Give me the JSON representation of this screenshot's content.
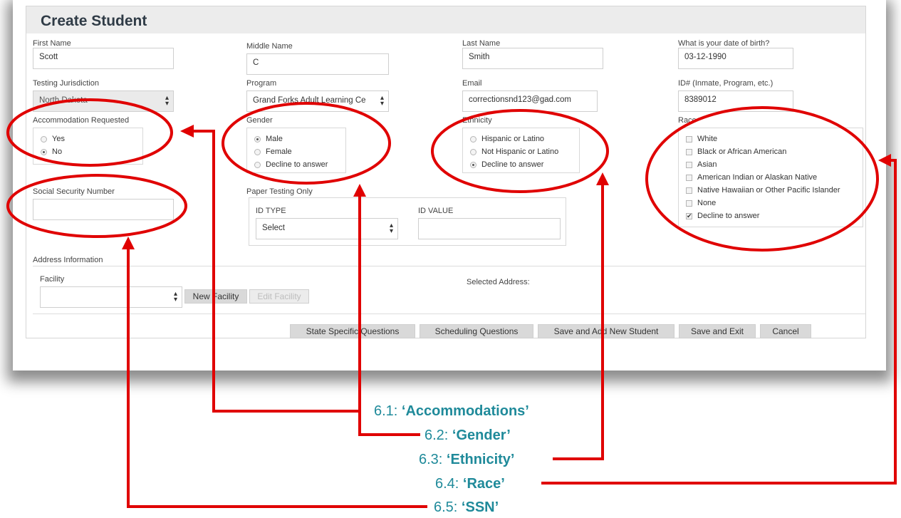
{
  "form": {
    "title": "Create Student",
    "first_name": {
      "label": "First Name",
      "value": "Scott"
    },
    "middle_name": {
      "label": "Middle Name",
      "value": "C"
    },
    "last_name": {
      "label": "Last Name",
      "value": "Smith"
    },
    "dob": {
      "label": "What is your date of birth?",
      "value": "03-12-1990"
    },
    "jurisdiction": {
      "label": "Testing Jurisdiction",
      "value": "North Dakota"
    },
    "program": {
      "label": "Program",
      "value": "Grand Forks Adult Learning Ce"
    },
    "email": {
      "label": "Email",
      "value": "correctionsnd123@gad.com"
    },
    "id_num": {
      "label": "ID# (Inmate, Program, etc.)",
      "value": "8389012"
    },
    "accommodation": {
      "label": "Accommodation Requested",
      "options": [
        "Yes",
        "No"
      ],
      "selected": "No"
    },
    "gender": {
      "label": "Gender",
      "options": [
        "Male",
        "Female",
        "Decline to answer"
      ],
      "selected": "Male"
    },
    "ethnicity": {
      "label": "Ethnicity",
      "options": [
        "Hispanic or Latino",
        "Not Hispanic or Latino",
        "Decline to answer"
      ],
      "selected": "Decline to answer"
    },
    "race": {
      "label": "Race",
      "options": [
        "White",
        "Black or African American",
        "Asian",
        "American Indian or Alaskan Native",
        "Native Hawaiian or Other Pacific Islander",
        "None",
        "Decline to answer"
      ],
      "checked": [
        "Decline to answer"
      ]
    },
    "ssn": {
      "label": "Social Security Number",
      "value": ""
    },
    "paper": {
      "label": "Paper Testing Only",
      "id_type_label": "ID TYPE",
      "id_type_value": "Select",
      "id_value_label": "ID VALUE",
      "id_value": ""
    },
    "address": {
      "label": "Address Information",
      "facility_label": "Facility",
      "facility_value": "",
      "new_facility": "New Facility",
      "edit_facility": "Edit Facility",
      "selected_address": "Selected Address:"
    },
    "buttons": {
      "state": "State Specific Questions",
      "scheduling": "Scheduling Questions",
      "save_add": "Save and Add New Student",
      "save_exit": "Save and Exit",
      "cancel": "Cancel"
    }
  },
  "annotations": {
    "a1_num": "6.1: ",
    "a1_name": "‘Accommodations’",
    "a2_num": "6.2: ",
    "a2_name": "‘Gender’",
    "a3_num": "6.3: ",
    "a3_name": "‘Ethnicity’",
    "a4_num": "6.4: ",
    "a4_name": "‘Race’",
    "a5_num": "6.5: ",
    "a5_name": "‘SSN’"
  },
  "colors": {
    "annotation": "#e00000",
    "caption": "#1f8a9a"
  }
}
